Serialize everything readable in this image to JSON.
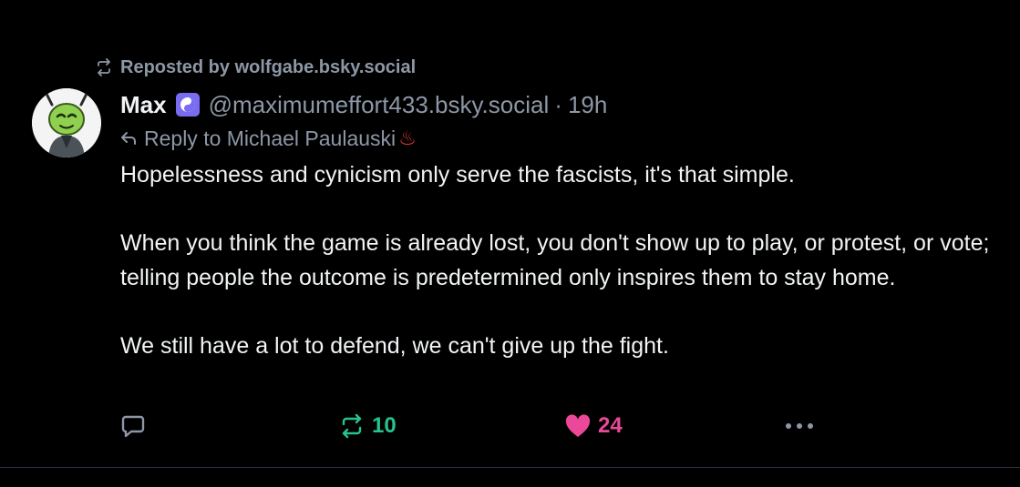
{
  "repost": {
    "label": "Reposted by wolfgabe.bsky.social",
    "icon": "repost-icon"
  },
  "author": {
    "display_name": "Max",
    "badge_icon": "yin-yang-badge-icon",
    "handle": "@maximumeffort433.bsky.social",
    "separator": "·",
    "timestamp": "19h",
    "avatar_icon": "cartoon-avatar-icon"
  },
  "reply_to": {
    "label": "Reply to Michael Paulauski",
    "emoji": "♨"
  },
  "post": {
    "paragraphs": [
      "Hopelessness and cynicism only serve the fascists, it's that simple.",
      "When you think the game is already lost, you don't show up to play, or protest, or vote; telling people the outcome is predetermined only inspires them to stay home.",
      "We still have a lot to defend, we can't give up the fight."
    ]
  },
  "actions": {
    "reply_icon": "comment-icon",
    "repost_icon": "repost-icon",
    "repost_count": "10",
    "like_icon": "heart-icon",
    "like_count": "24",
    "more_icon": "ellipsis-icon"
  },
  "colors": {
    "background": "#000000",
    "text": "#f1f3f5",
    "muted": "#8d97a6",
    "repost_active": "#27c290",
    "like_active": "#ec4899",
    "badge": "#7a6cf0"
  }
}
